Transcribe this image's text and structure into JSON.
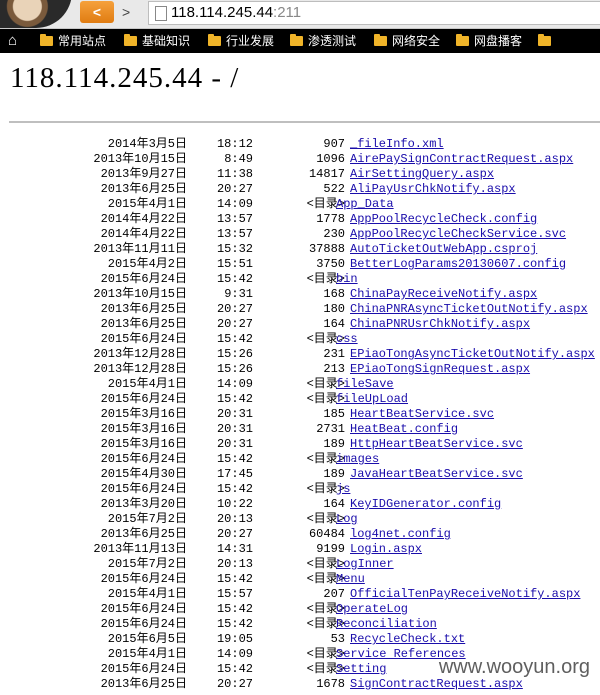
{
  "browser": {
    "back_label": "<",
    "forward_label": ">",
    "url_host": "118.114.245.44",
    "url_port": ":211"
  },
  "bookmarks": [
    "常用站点",
    "基础知识",
    "行业发展",
    "渗透测试",
    "网络安全",
    "网盘播客",
    ""
  ],
  "page": {
    "title": "118.114.245.44 - /"
  },
  "listing": [
    {
      "date": "2014年3月5日",
      "time": "18:12",
      "size": "907",
      "name": "_fileInfo.xml",
      "dir": false
    },
    {
      "date": "2013年10月15日",
      "time": "8:49",
      "size": "1096",
      "name": "AirePaySignContractRequest.aspx",
      "dir": false
    },
    {
      "date": "2013年9月27日",
      "time": "11:38",
      "size": "14817",
      "name": "AirSettingQuery.aspx",
      "dir": false
    },
    {
      "date": "2013年6月25日",
      "time": "20:27",
      "size": "522",
      "name": "AliPayUsrChkNotify.aspx",
      "dir": false
    },
    {
      "date": "2015年4月1日",
      "time": "14:09",
      "size": "<目录>",
      "name": "App_Data",
      "dir": true
    },
    {
      "date": "2014年4月22日",
      "time": "13:57",
      "size": "1778",
      "name": "AppPoolRecycleCheck.config",
      "dir": false
    },
    {
      "date": "2014年4月22日",
      "time": "13:57",
      "size": "230",
      "name": "AppPoolRecycleCheckService.svc",
      "dir": false
    },
    {
      "date": "2013年11月11日",
      "time": "15:32",
      "size": "37888",
      "name": "AutoTicketOutWebApp.csproj",
      "dir": false
    },
    {
      "date": "2015年4月2日",
      "time": "15:51",
      "size": "3750",
      "name": "BetterLogParams20130607.config",
      "dir": false
    },
    {
      "date": "2015年6月24日",
      "time": "15:42",
      "size": "<目录>",
      "name": "bin",
      "dir": true
    },
    {
      "date": "2013年10月15日",
      "time": "9:31",
      "size": "168",
      "name": "ChinaPayReceiveNotify.aspx",
      "dir": false
    },
    {
      "date": "2013年6月25日",
      "time": "20:27",
      "size": "180",
      "name": "ChinaPNRAsyncTicketOutNotify.aspx",
      "dir": false
    },
    {
      "date": "2013年6月25日",
      "time": "20:27",
      "size": "164",
      "name": "ChinaPNRUsrChkNotify.aspx",
      "dir": false
    },
    {
      "date": "2015年6月24日",
      "time": "15:42",
      "size": "<目录>",
      "name": "css",
      "dir": true
    },
    {
      "date": "2013年12月28日",
      "time": "15:26",
      "size": "231",
      "name": "EPiaoTongAsyncTicketOutNotify.aspx",
      "dir": false
    },
    {
      "date": "2013年12月28日",
      "time": "15:26",
      "size": "213",
      "name": "EPiaoTongSignRequest.aspx",
      "dir": false
    },
    {
      "date": "2015年4月1日",
      "time": "14:09",
      "size": "<目录>",
      "name": "fileSave",
      "dir": true
    },
    {
      "date": "2015年6月24日",
      "time": "15:42",
      "size": "<目录>",
      "name": "fileUpLoad",
      "dir": true
    },
    {
      "date": "2015年3月16日",
      "time": "20:31",
      "size": "185",
      "name": "HeartBeatService.svc",
      "dir": false
    },
    {
      "date": "2015年3月16日",
      "time": "20:31",
      "size": "2731",
      "name": "HeatBeat.config",
      "dir": false
    },
    {
      "date": "2015年3月16日",
      "time": "20:31",
      "size": "189",
      "name": "HttpHeartBeatService.svc",
      "dir": false
    },
    {
      "date": "2015年6月24日",
      "time": "15:42",
      "size": "<目录>",
      "name": "images",
      "dir": true
    },
    {
      "date": "2015年4月30日",
      "time": "17:45",
      "size": "189",
      "name": "JavaHeartBeatService.svc",
      "dir": false
    },
    {
      "date": "2015年6月24日",
      "time": "15:42",
      "size": "<目录>",
      "name": "js",
      "dir": true
    },
    {
      "date": "2013年3月20日",
      "time": "10:22",
      "size": "164",
      "name": "KeyIDGenerator.config",
      "dir": false
    },
    {
      "date": "2015年7月2日",
      "time": "20:13",
      "size": "<目录>",
      "name": "Log",
      "dir": true
    },
    {
      "date": "2013年6月25日",
      "time": "20:27",
      "size": "60484",
      "name": "log4net.config",
      "dir": false
    },
    {
      "date": "2013年11月13日",
      "time": "14:31",
      "size": "9199",
      "name": "Login.aspx",
      "dir": false
    },
    {
      "date": "2015年7月2日",
      "time": "20:13",
      "size": "<目录>",
      "name": "LogInner",
      "dir": true
    },
    {
      "date": "2015年6月24日",
      "time": "15:42",
      "size": "<目录>",
      "name": "Menu",
      "dir": true
    },
    {
      "date": "2015年4月1日",
      "time": "15:57",
      "size": "207",
      "name": "OfficialTenPayReceiveNotify.aspx",
      "dir": false
    },
    {
      "date": "2015年6月24日",
      "time": "15:42",
      "size": "<目录>",
      "name": "OperateLog",
      "dir": true
    },
    {
      "date": "2015年6月24日",
      "time": "15:42",
      "size": "<目录>",
      "name": "Reconciliation",
      "dir": true
    },
    {
      "date": "2015年6月5日",
      "time": "19:05",
      "size": "53",
      "name": "RecycleCheck.txt",
      "dir": false
    },
    {
      "date": "2015年4月1日",
      "time": "14:09",
      "size": "<目录>",
      "name": "Service References",
      "dir": true
    },
    {
      "date": "2015年6月24日",
      "time": "15:42",
      "size": "<目录>",
      "name": "Setting",
      "dir": true
    },
    {
      "date": "2013年6月25日",
      "time": "20:27",
      "size": "1678",
      "name": "SignContractRequest.aspx",
      "dir": false
    }
  ],
  "watermark": "www.wooyun.org",
  "colors": {
    "link": "#1a0dab",
    "back_button": "#e07c12",
    "bookmark_bar": "#000000"
  }
}
